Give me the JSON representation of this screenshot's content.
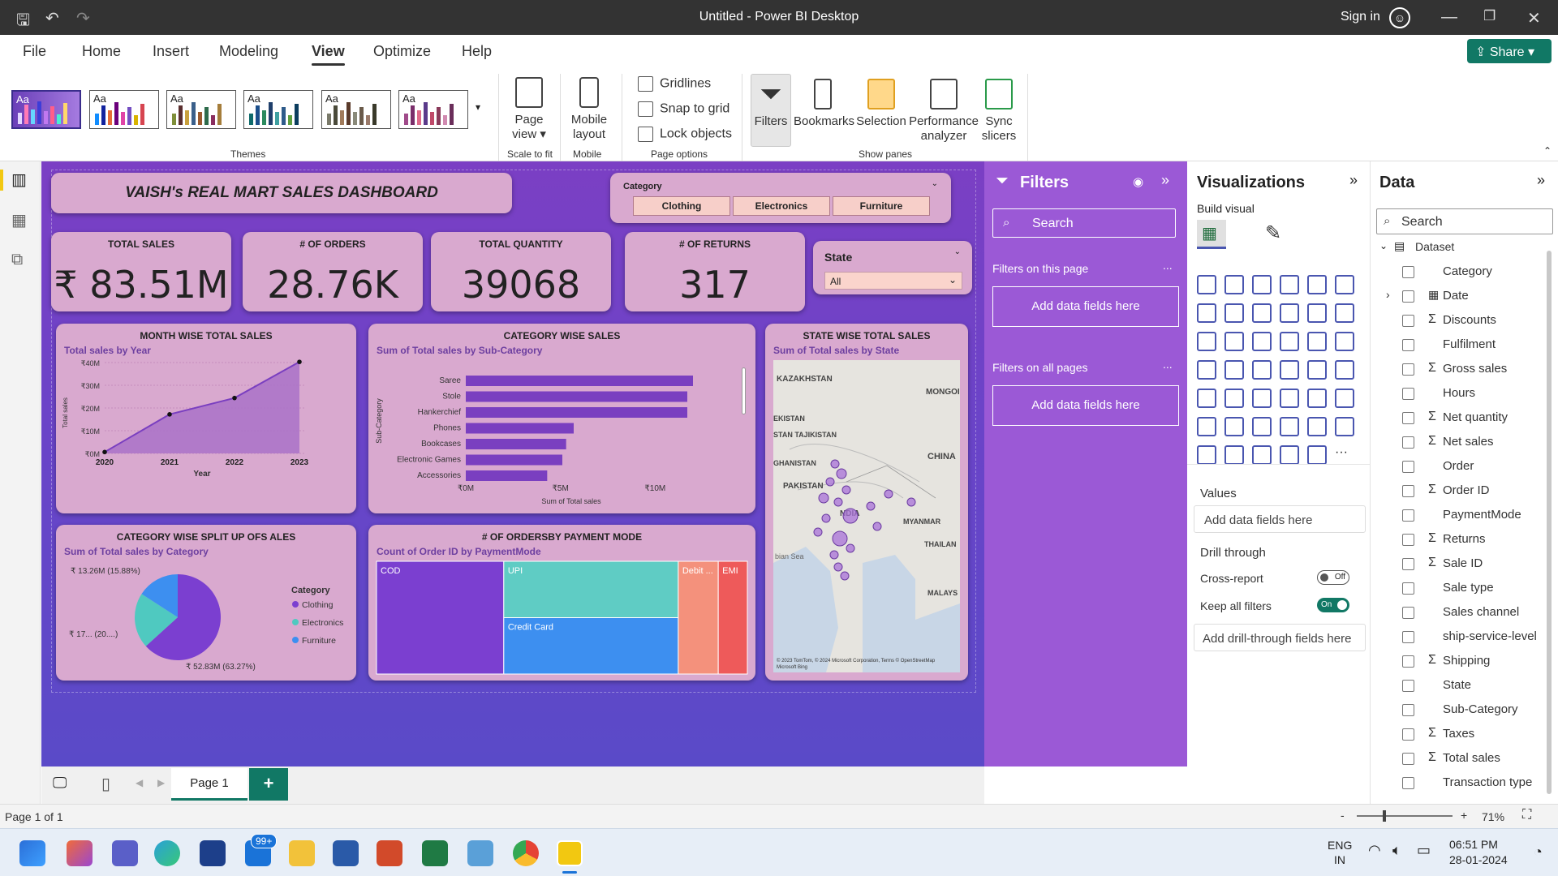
{
  "window": {
    "title": "Untitled - Power BI Desktop",
    "sign_in": "Sign in"
  },
  "menu": [
    "File",
    "Home",
    "Insert",
    "Modeling",
    "View",
    "Optimize",
    "Help"
  ],
  "menu_active": "View",
  "share": "Share",
  "ribbon": {
    "theme_label": "Aa",
    "groups": {
      "themes": "Themes",
      "scale": "Scale to fit",
      "mobile": "Mobile",
      "page_options": "Page options",
      "show_panes": "Show panes"
    },
    "page_view": "Page view",
    "mobile_layout": "Mobile layout",
    "checkboxes": [
      "Gridlines",
      "Snap to grid",
      "Lock objects"
    ],
    "panes": [
      "Filters",
      "Bookmarks",
      "Selection",
      "Performance analyzer",
      "Sync slicers"
    ]
  },
  "dashboard": {
    "title": "VAISH's REAL MART SALES DASHBOARD",
    "category_slicer": {
      "label": "Category",
      "options": [
        "Clothing",
        "Electronics",
        "Furniture"
      ]
    },
    "kpis": [
      {
        "label": "TOTAL SALES",
        "value": "₹ 83.51M"
      },
      {
        "label": "# OF ORDERS",
        "value": "28.76K"
      },
      {
        "label": "TOTAL QUANTITY",
        "value": "39068"
      },
      {
        "label": "# OF RETURNS",
        "value": "317"
      }
    ],
    "state_slicer": {
      "label": "State",
      "value": "All"
    },
    "month_chart": {
      "title": "MONTH WISE TOTAL SALES",
      "subtitle": "Total sales by Year"
    },
    "category_chart": {
      "title": "CATEGORY WISE SALES",
      "subtitle": "Sum of Total sales by Sub-Category"
    },
    "state_map": {
      "title": "STATE WISE TOTAL SALES",
      "subtitle": "Sum of Total sales by State",
      "labels": [
        "KAZAKHSTAN",
        "MONGOI",
        "EKISTAN",
        "STAN TAJIKISTAN",
        "GHANISTAN",
        "PAKISTAN",
        "CHINA",
        "NDIA",
        "MYANMAR",
        "THAILAN",
        "MALAYS",
        "bian Sea"
      ],
      "credit": "© 2023 TomTom, © 2024 Microsoft Corporation, Terms © OpenStreetMap",
      "bing": "Microsoft Bing"
    },
    "pie_chart": {
      "title": "CATEGORY WISE SPLIT UP OFS ALES",
      "subtitle": "Sum of Total sales by Category"
    },
    "treemap": {
      "title": "# OF ORDERSBY PAYMENT MODE",
      "subtitle": "Count of Order ID by PaymentMode"
    }
  },
  "chart_data": [
    {
      "type": "area",
      "title": "Total sales by Year",
      "xlabel": "Year",
      "ylabel": "Total sales",
      "x": [
        "2020",
        "2021",
        "2022",
        "2023"
      ],
      "values": [
        0.6,
        17.2,
        24.4,
        40.3
      ],
      "ylim": [
        0,
        40
      ],
      "yticks": [
        "₹0M",
        "₹10M",
        "₹20M",
        "₹30M",
        "₹40M"
      ],
      "color": "#7a3fc0"
    },
    {
      "type": "bar",
      "orientation": "horizontal",
      "title": "Sum of Total sales by Sub-Category",
      "xlabel": "Sum of Total sales",
      "ylabel": "Sub-Category",
      "categories": [
        "Saree",
        "Stole",
        "Hankerchief",
        "Phones",
        "Bookcases",
        "Electronic Games",
        "Accessories"
      ],
      "values": [
        12.0,
        11.7,
        11.7,
        5.7,
        5.3,
        5.1,
        4.3
      ],
      "xlim": [
        0,
        12
      ],
      "xticks": [
        "₹0M",
        "₹5M",
        "₹10M"
      ],
      "color": "#7a3fc0"
    },
    {
      "type": "pie",
      "title": "Sum of Total sales by Category",
      "legend_title": "Category",
      "labels": [
        "Clothing",
        "Electronics",
        "Furniture"
      ],
      "values": [
        63.27,
        20.85,
        15.88
      ],
      "colors": [
        "#7b3fd0",
        "#4fc9c0",
        "#3d8ff0"
      ],
      "data_labels": [
        "₹ 52.83M (63.27%)",
        "₹ 17... (20....)",
        "₹ 13.26M (15.88%)"
      ]
    },
    {
      "type": "treemap",
      "title": "Count of Order ID by PaymentMode",
      "labels": [
        "COD",
        "UPI",
        "Credit Card",
        "Debit ...",
        "EMI"
      ],
      "values": [
        35,
        24,
        24,
        11,
        8
      ],
      "colors": [
        "#7b3fd0",
        "#5fccc4",
        "#3d8ff0",
        "#f4917c",
        "#ee5a5a"
      ]
    }
  ],
  "filters_pane": {
    "title": "Filters",
    "search": "Search",
    "on_page": "Filters on this page",
    "all_pages": "Filters on all pages",
    "add": "Add data fields here",
    "more": "..."
  },
  "viz_pane": {
    "title": "Visualizations",
    "build": "Build visual",
    "values": "Values",
    "add_values": "Add data fields here",
    "drill_through": "Drill through",
    "cross_report": "Cross-report",
    "cross_state": "Off",
    "keep_filters": "Keep all filters",
    "keep_state": "On",
    "add_drill": "Add drill-through fields here"
  },
  "data_pane": {
    "title": "Data",
    "search": "Search",
    "dataset": "Dataset",
    "fields": [
      {
        "name": "Category",
        "sigma": false
      },
      {
        "name": "Date",
        "sigma": false,
        "table": true
      },
      {
        "name": "Discounts",
        "sigma": true
      },
      {
        "name": "Fulfilment",
        "sigma": false
      },
      {
        "name": "Gross sales",
        "sigma": true
      },
      {
        "name": "Hours",
        "sigma": false
      },
      {
        "name": "Net quantity",
        "sigma": true
      },
      {
        "name": "Net sales",
        "sigma": true
      },
      {
        "name": "Order",
        "sigma": false
      },
      {
        "name": "Order ID",
        "sigma": true
      },
      {
        "name": "PaymentMode",
        "sigma": false
      },
      {
        "name": "Returns",
        "sigma": true
      },
      {
        "name": "Sale ID",
        "sigma": true
      },
      {
        "name": "Sale type",
        "sigma": false
      },
      {
        "name": "Sales channel",
        "sigma": false
      },
      {
        "name": "ship-service-level",
        "sigma": false
      },
      {
        "name": "Shipping",
        "sigma": true
      },
      {
        "name": "State",
        "sigma": false
      },
      {
        "name": "Sub-Category",
        "sigma": false
      },
      {
        "name": "Taxes",
        "sigma": true
      },
      {
        "name": "Total sales",
        "sigma": true
      },
      {
        "name": "Transaction type",
        "sigma": false
      }
    ]
  },
  "pages": {
    "tab": "Page 1",
    "add": "+"
  },
  "status": {
    "page": "Page 1 of 1",
    "zoom": "71%"
  },
  "taskbar": {
    "badge": "99+",
    "lang1": "ENG",
    "lang2": "IN",
    "time": "06:51 PM",
    "date": "28-01-2024"
  }
}
